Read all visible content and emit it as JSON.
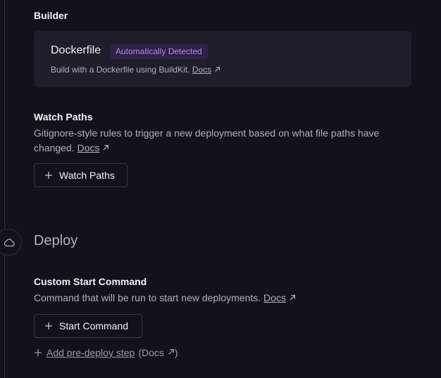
{
  "builder": {
    "section_label": "Builder",
    "name": "Dockerfile",
    "badge": "Automatically Detected",
    "description": "Build with a Dockerfile using BuildKit.",
    "docs_link": "Docs"
  },
  "watch_paths": {
    "section_label": "Watch Paths",
    "description": "Gitignore-style rules to trigger a new deployment based on what file paths have changed.",
    "docs_link": "Docs",
    "button_label": "Watch Paths"
  },
  "deploy": {
    "heading": "Deploy",
    "rail_icon": "cloud-icon",
    "custom_start": {
      "section_label": "Custom Start Command",
      "description": "Command that will be run to start new deployments.",
      "docs_link": "Docs",
      "button_label": "Start Command"
    },
    "pre_deploy": {
      "link_label": "Add pre-deploy step",
      "docs_prefix": "(",
      "docs_link": "Docs",
      "docs_suffix": ")"
    }
  },
  "colors": {
    "background": "#13111c",
    "card": "#1f1d29",
    "badge_bg": "#2e2144",
    "badge_text": "#b587f5",
    "muted_text": "#b3b0be"
  }
}
